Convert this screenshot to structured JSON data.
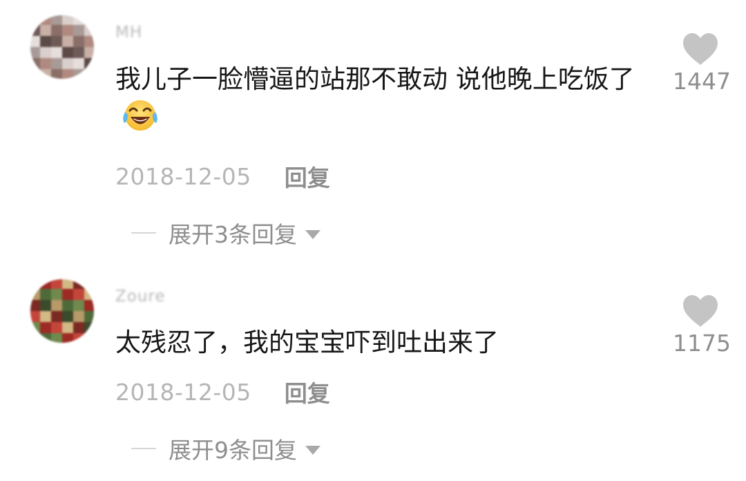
{
  "comments": [
    {
      "username": "MH",
      "text": "我儿子一脸懵逼的站那不敢动 说他晚上吃饭了",
      "emoji_icon": "tears-of-joy-icon",
      "date": "2018-12-05",
      "reply_label": "回复",
      "expand_label": "展开3条回复",
      "likes": "1447",
      "avatar_palette": [
        "#8a6f68",
        "#b08a80",
        "#6e5a57",
        "#c8b0a6",
        "#e6dedb",
        "#5c4a47",
        "#a89a96",
        "#d9cfcc"
      ]
    },
    {
      "username": "Zoure",
      "text": "太残忍了，我的宝宝吓到吐出来了",
      "date": "2018-12-05",
      "reply_label": "回复",
      "expand_label": "展开9条回复",
      "likes": "1175",
      "avatar_palette": [
        "#9d2a24",
        "#c4463b",
        "#4f6a3a",
        "#6f8a4c",
        "#3a4a2a",
        "#b89a6a",
        "#d2b985",
        "#7a2a22"
      ]
    }
  ],
  "like_icon_color": "#c4c4c4"
}
